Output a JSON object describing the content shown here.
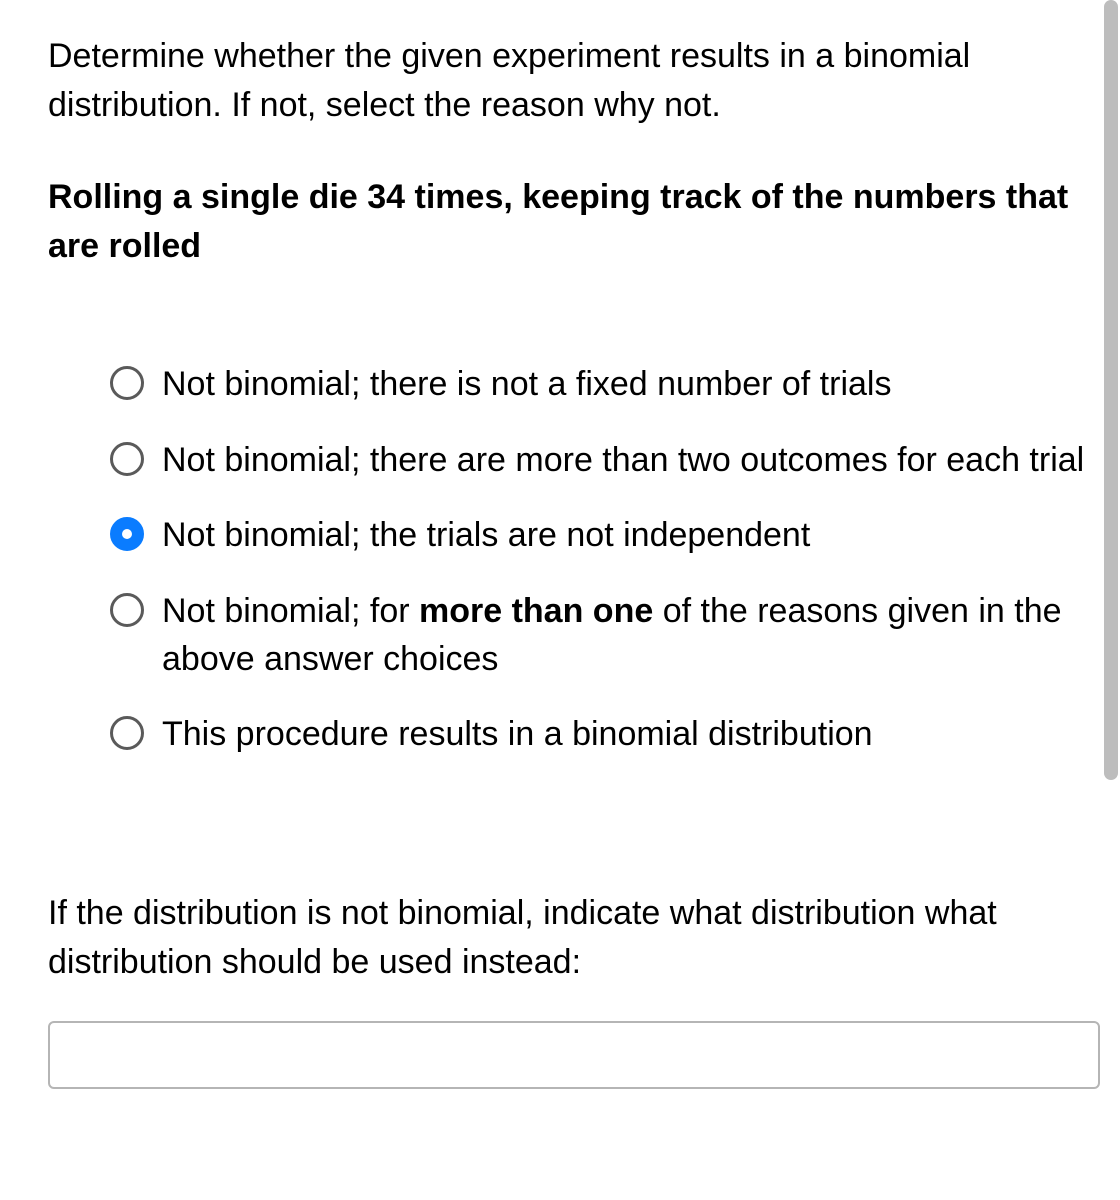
{
  "question": {
    "intro": "Determine whether the given experiment results in a binomial distribution. If not, select the reason why not.",
    "scenario": "Rolling a single die 34 times, keeping track of the numbers that are rolled"
  },
  "options": [
    {
      "text": "Not binomial; there is not a fixed number of trials",
      "selected": false
    },
    {
      "text": "Not binomial; there are more than two outcomes for each trial",
      "selected": false
    },
    {
      "text": "Not binomial; the trials are not independent",
      "selected": true
    },
    {
      "text_pre": "Not binomial; for ",
      "text_bold": "more than one",
      "text_post": " of the reasons given in the above answer choices",
      "selected": false
    },
    {
      "text": "This procedure results in a binomial distribution",
      "selected": false
    }
  ],
  "followup": {
    "prompt": "If the distribution is not binomial, indicate what distribution what distribution should be used instead:",
    "value": ""
  }
}
